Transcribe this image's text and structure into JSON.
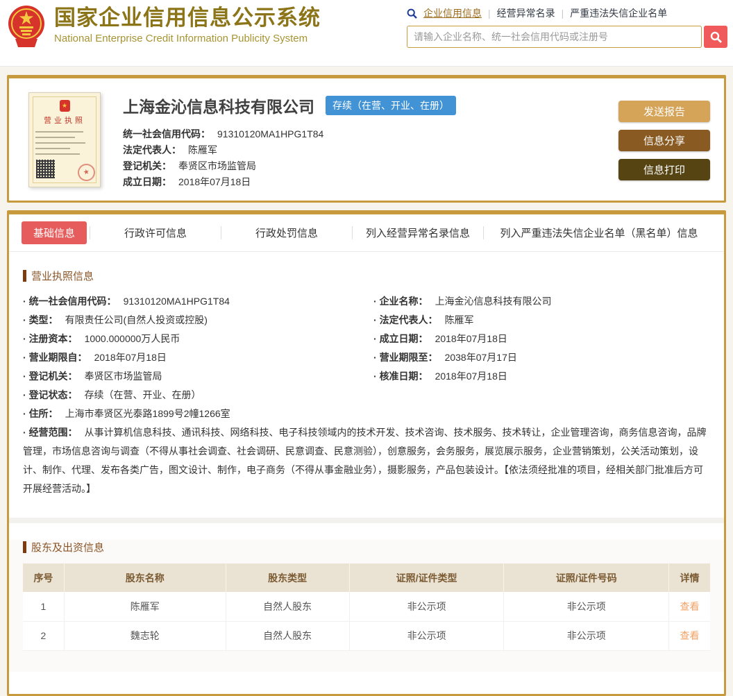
{
  "header": {
    "site_title": "国家企业信用信息公示系统",
    "site_subtitle": "National Enterprise Credit Information Publicity System",
    "nav": {
      "separator": "|",
      "links": [
        "企业信用信息",
        "经营异常名录",
        "严重违法失信企业名单"
      ]
    },
    "search": {
      "placeholder": "请输入企业名称、统一社会信用代码或注册号"
    }
  },
  "company_card": {
    "name": "上海金沁信息科技有限公司",
    "status_badge": "存续（在营、开业、在册）",
    "license_thumb_label": "营业执照",
    "fields": [
      {
        "label": "统一社会信用代码：",
        "value": "91310120MA1HPG1T84"
      },
      {
        "label": "法定代表人：",
        "value": "陈雁军"
      },
      {
        "label": "登记机关：",
        "value": "奉贤区市场监管局"
      },
      {
        "label": "成立日期：",
        "value": "2018年07月18日"
      }
    ],
    "buttons": [
      "发送报告",
      "信息分享",
      "信息打印"
    ]
  },
  "tabs": [
    "基础信息",
    "行政许可信息",
    "行政处罚信息",
    "列入经营异常名录信息",
    "列入严重违法失信企业名单（黑名单）信息"
  ],
  "license_section": {
    "title": "营业执照信息",
    "left": [
      {
        "label": "统一社会信用代码：",
        "value": "91310120MA1HPG1T84"
      },
      {
        "label": "类型：",
        "value": "有限责任公司(自然人投资或控股)"
      },
      {
        "label": "注册资本：",
        "value": "1000.000000万人民币"
      },
      {
        "label": "营业期限自：",
        "value": "2018年07月18日"
      },
      {
        "label": "登记机关：",
        "value": "奉贤区市场监管局"
      }
    ],
    "right": [
      {
        "label": "企业名称：",
        "value": "上海金沁信息科技有限公司"
      },
      {
        "label": "法定代表人：",
        "value": "陈雁军"
      },
      {
        "label": "成立日期：",
        "value": "2018年07月18日"
      },
      {
        "label": "营业期限至：",
        "value": "2038年07月17日"
      },
      {
        "label": "核准日期：",
        "value": "2018年07月18日"
      }
    ],
    "full": [
      {
        "label": "登记状态：",
        "value": "存续（在营、开业、在册）"
      },
      {
        "label": "住所：",
        "value": "上海市奉贤区光泰路1899号2幢1266室"
      },
      {
        "label": "经营范围：",
        "value": "从事计算机信息科技、通讯科技、网络科技、电子科技领域内的技术开发、技术咨询、技术服务、技术转让，企业管理咨询，商务信息咨询，品牌管理，市场信息咨询与调查（不得从事社会调查、社会调研、民意调查、民意测验），创意服务，会务服务，展览展示服务，企业营销策划，公关活动策划，设计、制作、代理、发布各类广告，图文设计、制作，电子商务（不得从事金融业务），摄影服务，产品包装设计。【依法须经批准的项目，经相关部门批准后方可开展经营活动。】"
      }
    ]
  },
  "shareholder_section": {
    "title": "股东及出资信息",
    "table": {
      "headers": [
        "序号",
        "股东名称",
        "股东类型",
        "证照/证件类型",
        "证照/证件号码",
        "详情"
      ],
      "rows": [
        [
          "1",
          "陈雁军",
          "自然人股东",
          "非公示项",
          "非公示项",
          "查看"
        ],
        [
          "2",
          "魏志轮",
          "自然人股东",
          "非公示项",
          "非公示项",
          "查看"
        ]
      ]
    }
  },
  "colors": {
    "gold_border": "#C79A3D",
    "page_background": "#F7F4EE",
    "title_gold": "#8C7418",
    "active_tab_red": "#E65C5C",
    "status_badge_blue": "#4293D6",
    "search_button_red": "#F05A5A",
    "button_report": "#D5A458",
    "button_share": "#8A5A23",
    "button_print": "#564413",
    "section_brown": "#8A5427",
    "table_header_bg": "#EAE2D2",
    "view_link_orange": "#F2A266"
  }
}
